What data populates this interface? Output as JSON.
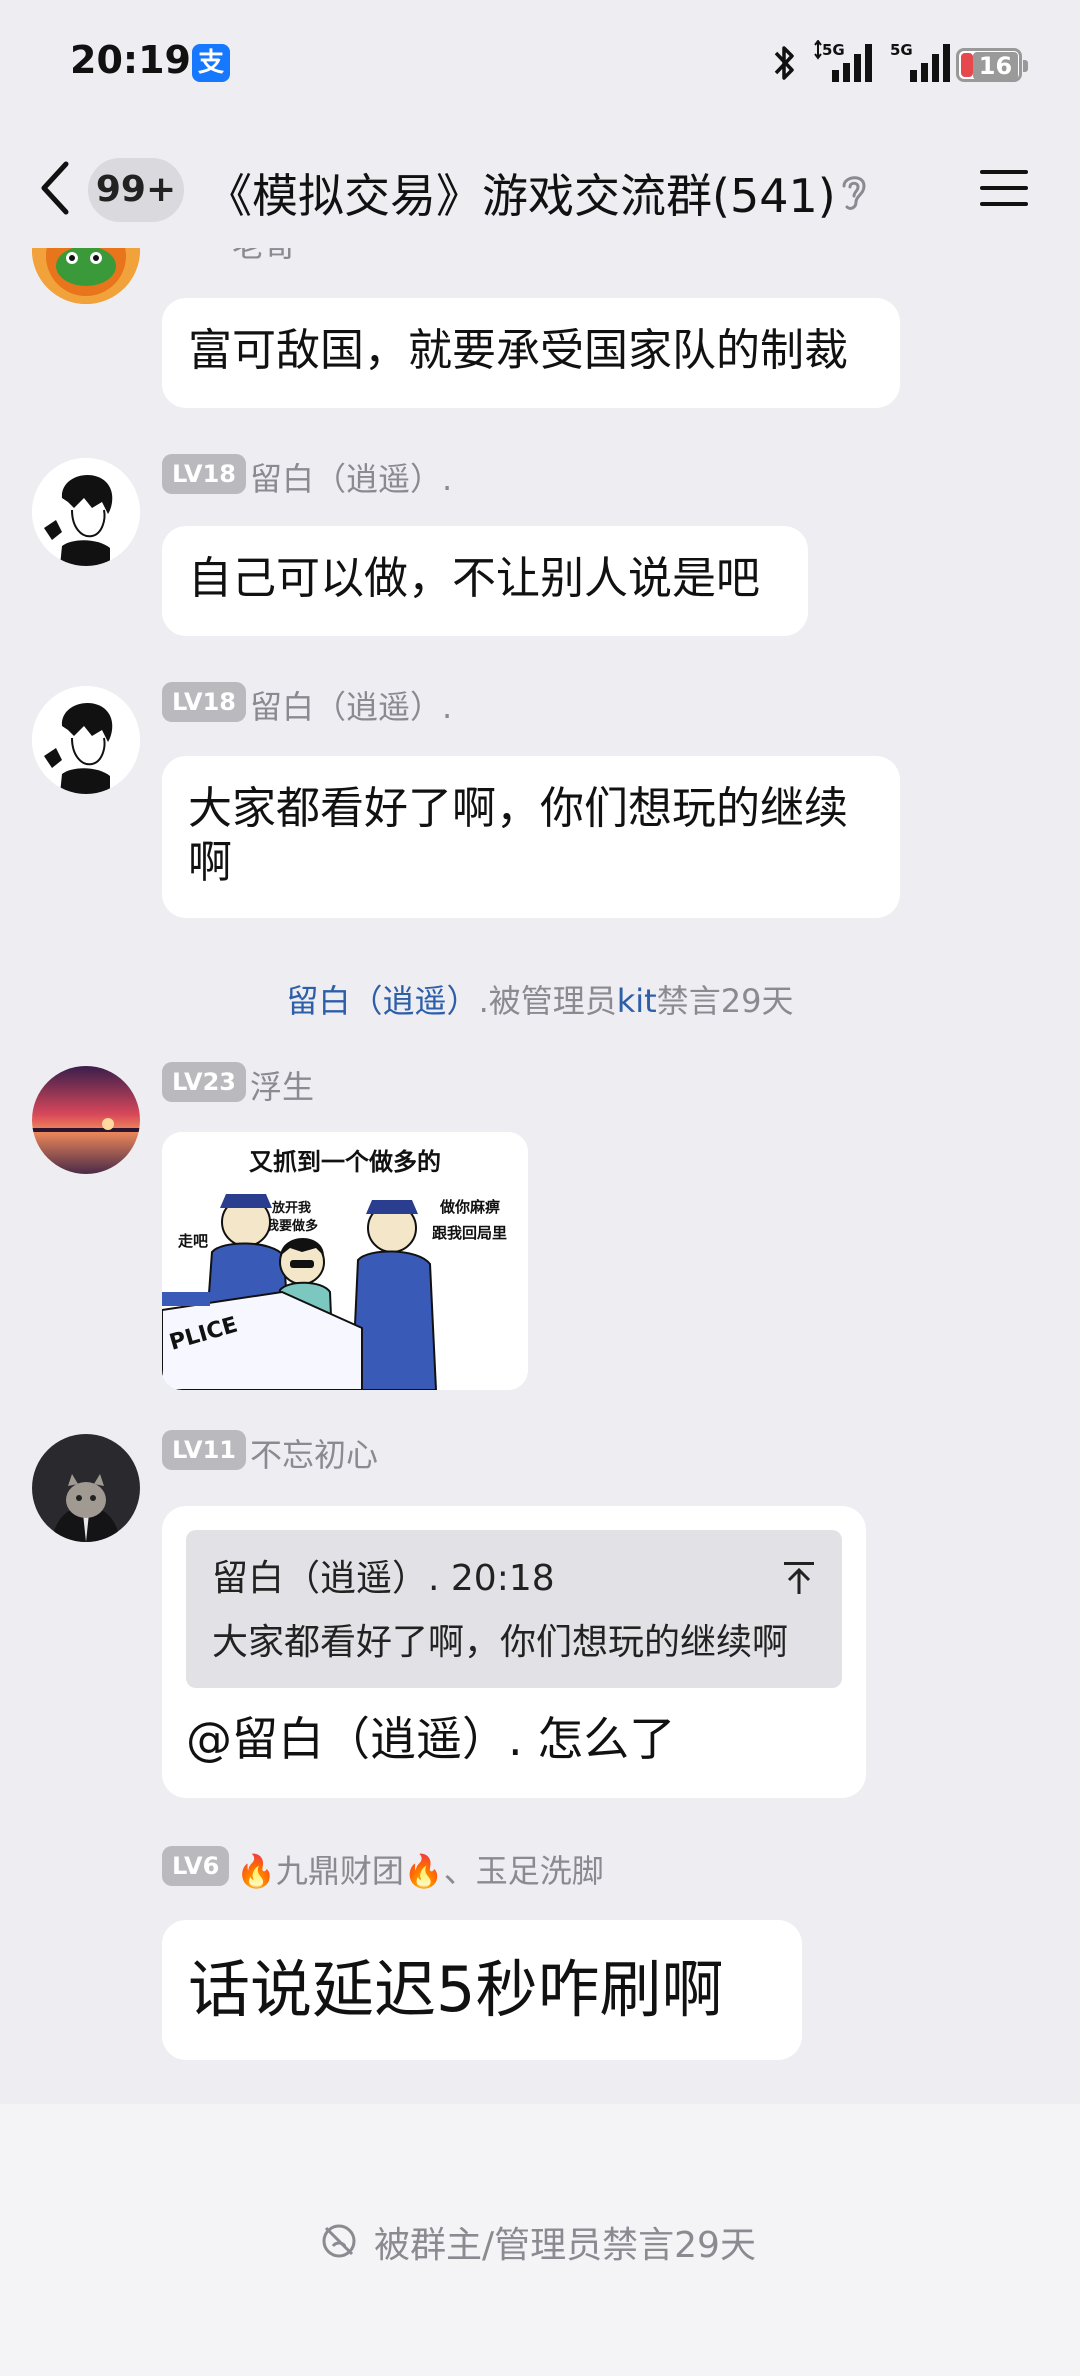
{
  "status_bar": {
    "time": "20:19",
    "alipay_glyph": "支",
    "network_1": "5G",
    "network_2": "5G",
    "battery": "16"
  },
  "header": {
    "unread_count": "99+",
    "title": "《模拟交易》游戏交流群(541)"
  },
  "messages": [
    {
      "name_partial": "老哥",
      "text": "富可敌国，就要承受国家队的制裁"
    },
    {
      "level": "LV18",
      "name": "留白（逍遥）.",
      "text": "自己可以做，不让别人说是吧"
    },
    {
      "level": "LV18",
      "name": "留白（逍遥）.",
      "text_line1": "大家都看好了啊，你们想玩的继续",
      "text_line2": "啊"
    },
    {
      "level": "LV23",
      "name": "浮生",
      "sticker": {
        "caption": "又抓到一个做多的",
        "left": "走吧",
        "middle": "放开我\n我要做多",
        "right": "做你麻痹\n跟我回局里",
        "car": "PLICE"
      }
    },
    {
      "level": "LV11",
      "name": "不忘初心",
      "quote_header": "留白（逍遥）. 20:18",
      "quote_text": "大家都看好了啊，你们想玩的继续啊",
      "text": "@留白（逍遥）. 怎么了"
    },
    {
      "level": "LV6",
      "name": "🔥九鼎财团🔥、玉足洗脚",
      "text": "话说延迟5秒咋刷啊"
    }
  ],
  "system_message": {
    "user": "留白（逍遥）",
    "middle": ".被管理员",
    "admin": "kit",
    "suffix": "禁言29天"
  },
  "footer": {
    "muted_text": "被群主/管理员禁言29天"
  },
  "icons": [
    "back-icon",
    "ear-icon",
    "menu-icon",
    "bluetooth-icon",
    "signal-icon",
    "battery-icon",
    "quote-up-icon",
    "mute-icon"
  ]
}
